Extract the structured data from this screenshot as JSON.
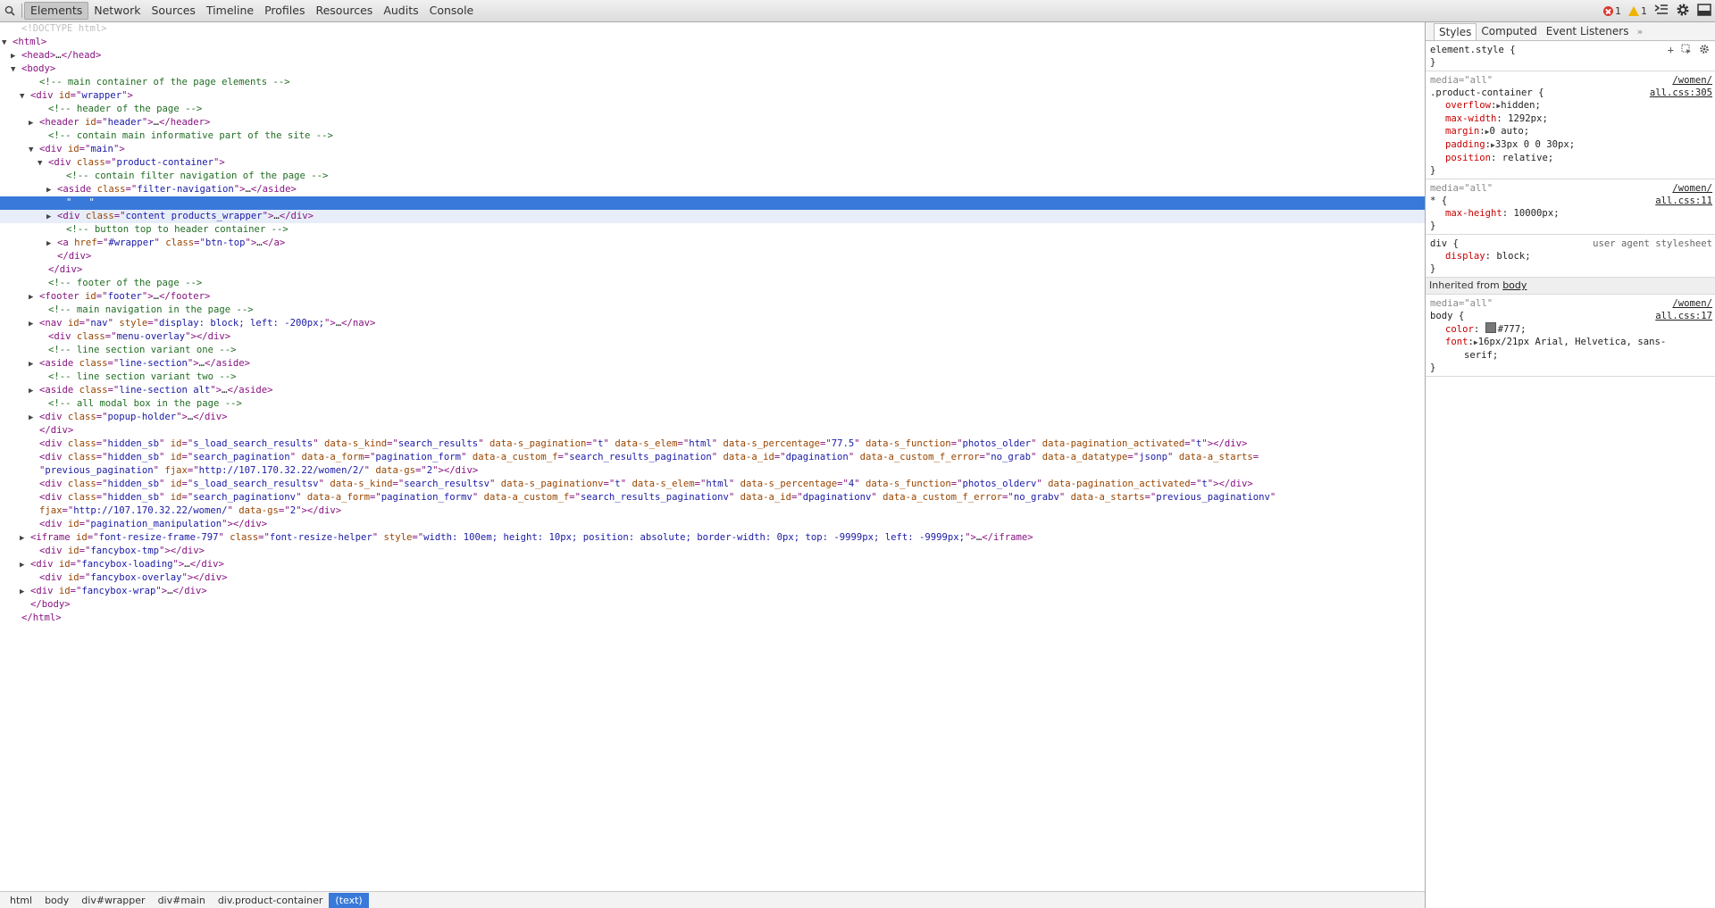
{
  "toolbar": {
    "tabs": [
      "Elements",
      "Network",
      "Sources",
      "Timeline",
      "Profiles",
      "Resources",
      "Audits",
      "Console"
    ],
    "error_count": "1",
    "warning_count": "1"
  },
  "dom_lines": [
    {
      "ind": 1,
      "tri": "",
      "html": "<span class='doctype'>&lt;!DOCTYPE html&gt;</span>"
    },
    {
      "ind": 0,
      "tri": "▼",
      "html": "<span class='tag'>&lt;html&gt;</span>"
    },
    {
      "ind": 1,
      "tri": "▶",
      "html": "<span class='tag'>&lt;head&gt;</span>…<span class='tag'>&lt;/head&gt;</span>"
    },
    {
      "ind": 1,
      "tri": "▼",
      "html": "<span class='tag'>&lt;body&gt;</span>"
    },
    {
      "ind": 3,
      "tri": "",
      "html": "<span class='cmt'>&lt;!-- main container of the page elements --&gt;</span>"
    },
    {
      "ind": 2,
      "tri": "▼",
      "html": "<span class='tag'>&lt;div </span><span class='attr'>id</span><span class='tag'>=\"</span><span class='val'>wrapper</span><span class='tag'>\"&gt;</span>"
    },
    {
      "ind": 4,
      "tri": "",
      "html": "<span class='cmt'>&lt;!-- header of the page --&gt;</span>"
    },
    {
      "ind": 3,
      "tri": "▶",
      "html": "<span class='tag'>&lt;header </span><span class='attr'>id</span><span class='tag'>=\"</span><span class='val'>header</span><span class='tag'>\"&gt;</span>…<span class='tag'>&lt;/header&gt;</span>"
    },
    {
      "ind": 4,
      "tri": "",
      "html": "<span class='cmt'>&lt;!-- contain main informative part of the site --&gt;</span>"
    },
    {
      "ind": 3,
      "tri": "▼",
      "html": "<span class='tag'>&lt;div </span><span class='attr'>id</span><span class='tag'>=\"</span><span class='val'>main</span><span class='tag'>\"&gt;</span>"
    },
    {
      "ind": 4,
      "tri": "▼",
      "html": "<span class='tag'>&lt;div </span><span class='attr'>class</span><span class='tag'>=\"</span><span class='val'>product-container</span><span class='tag'>\"&gt;</span>"
    },
    {
      "ind": 6,
      "tri": "",
      "html": "<span class='cmt'>&lt;!-- contain filter navigation of the page --&gt;</span>"
    },
    {
      "ind": 5,
      "tri": "▶",
      "html": "<span class='tag'>&lt;aside </span><span class='attr'>class</span><span class='tag'>=\"</span><span class='val'>filter-navigation</span><span class='tag'>\"&gt;</span>…<span class='tag'>&lt;/aside&gt;</span>"
    },
    {
      "ind": 6,
      "tri": "",
      "html": "\"   \"",
      "sel": true
    },
    {
      "ind": 5,
      "tri": "▶",
      "html": "<span class='tag'>&lt;div </span><span class='attr'>class</span><span class='tag'>=\"</span><span class='val'>content products_wrapper</span><span class='tag'>\"&gt;</span>…<span class='tag'>&lt;/div&gt;</span>",
      "hover": true
    },
    {
      "ind": 6,
      "tri": "",
      "html": "<span class='cmt'>&lt;!-- button top to header container --&gt;</span>"
    },
    {
      "ind": 5,
      "tri": "▶",
      "html": "<span class='tag'>&lt;a </span><span class='attr'>href</span><span class='tag'>=\"</span><span class='val'>#wrapper</span><span class='tag'>\" </span><span class='attr'>class</span><span class='tag'>=\"</span><span class='val'>btn-top</span><span class='tag'>\"&gt;</span>…<span class='tag'>&lt;/a&gt;</span>"
    },
    {
      "ind": 5,
      "tri": "",
      "html": "<span class='tag'>&lt;/div&gt;</span>"
    },
    {
      "ind": 4,
      "tri": "",
      "html": "<span class='tag'>&lt;/div&gt;</span>"
    },
    {
      "ind": 4,
      "tri": "",
      "html": "<span class='cmt'>&lt;!-- footer of the page --&gt;</span>"
    },
    {
      "ind": 3,
      "tri": "▶",
      "html": "<span class='tag'>&lt;footer </span><span class='attr'>id</span><span class='tag'>=\"</span><span class='val'>footer</span><span class='tag'>\"&gt;</span>…<span class='tag'>&lt;/footer&gt;</span>"
    },
    {
      "ind": 4,
      "tri": "",
      "html": "<span class='cmt'>&lt;!-- main navigation in the page --&gt;</span>"
    },
    {
      "ind": 3,
      "tri": "▶",
      "html": "<span class='tag'>&lt;nav </span><span class='attr'>id</span><span class='tag'>=\"</span><span class='val'>nav</span><span class='tag'>\" </span><span class='attr'>style</span><span class='tag'>=\"</span><span class='val'>display: block; left: -200px;</span><span class='tag'>\"&gt;</span>…<span class='tag'>&lt;/nav&gt;</span>"
    },
    {
      "ind": 4,
      "tri": "",
      "html": "<span class='tag'>&lt;div </span><span class='attr'>class</span><span class='tag'>=\"</span><span class='val'>menu-overlay</span><span class='tag'>\"&gt;&lt;/div&gt;</span>"
    },
    {
      "ind": 4,
      "tri": "",
      "html": "<span class='cmt'>&lt;!-- line section variant one --&gt;</span>"
    },
    {
      "ind": 3,
      "tri": "▶",
      "html": "<span class='tag'>&lt;aside </span><span class='attr'>class</span><span class='tag'>=\"</span><span class='val'>line-section</span><span class='tag'>\"&gt;</span>…<span class='tag'>&lt;/aside&gt;</span>"
    },
    {
      "ind": 4,
      "tri": "",
      "html": "<span class='cmt'>&lt;!-- line section variant two --&gt;</span>"
    },
    {
      "ind": 3,
      "tri": "▶",
      "html": "<span class='tag'>&lt;aside </span><span class='attr'>class</span><span class='tag'>=\"</span><span class='val'>line-section alt</span><span class='tag'>\"&gt;</span>…<span class='tag'>&lt;/aside&gt;</span>"
    },
    {
      "ind": 4,
      "tri": "",
      "html": "<span class='cmt'>&lt;!-- all modal box in the page --&gt;</span>"
    },
    {
      "ind": 3,
      "tri": "▶",
      "html": "<span class='tag'>&lt;div </span><span class='attr'>class</span><span class='tag'>=\"</span><span class='val'>popup-holder</span><span class='tag'>\"&gt;</span>…<span class='tag'>&lt;/div&gt;</span>"
    },
    {
      "ind": 3,
      "tri": "",
      "html": "<span class='tag'>&lt;/div&gt;</span>"
    },
    {
      "ind": 3,
      "tri": "",
      "html": "<span class='tag'>&lt;div </span><span class='attr'>class</span><span class='tag'>=\"</span><span class='val'>hidden_sb</span><span class='tag'>\" </span><span class='attr'>id</span><span class='tag'>=\"</span><span class='val'>s_load_search_results</span><span class='tag'>\" </span><span class='attr'>data-s_kind</span><span class='tag'>=\"</span><span class='val'>search_results</span><span class='tag'>\" </span><span class='attr'>data-s_pagination</span><span class='tag'>=\"</span><span class='val'>t</span><span class='tag'>\" </span><span class='attr'>data-s_elem</span><span class='tag'>=\"</span><span class='val'>html</span><span class='tag'>\" </span><span class='attr'>data-s_percentage</span><span class='tag'>=\"</span><span class='val'>77.5</span><span class='tag'>\" </span><span class='attr'>data-s_function</span><span class='tag'>=\"</span><span class='val'>photos_older</span><span class='tag'>\" </span><span class='attr'>data-pagination_activated</span><span class='tag'>=\"</span><span class='val'>t</span><span class='tag'>\"&gt;&lt;/div&gt;</span>"
    },
    {
      "ind": 3,
      "tri": "",
      "html": "<span class='tag'>&lt;div </span><span class='attr'>class</span><span class='tag'>=\"</span><span class='val'>hidden_sb</span><span class='tag'>\" </span><span class='attr'>id</span><span class='tag'>=\"</span><span class='val'>search_pagination</span><span class='tag'>\" </span><span class='attr'>data-a_form</span><span class='tag'>=\"</span><span class='val'>pagination_form</span><span class='tag'>\" </span><span class='attr'>data-a_custom_f</span><span class='tag'>=\"</span><span class='val'>search_results_pagination</span><span class='tag'>\" </span><span class='attr'>data-a_id</span><span class='tag'>=\"</span><span class='val'>dpagination</span><span class='tag'>\" </span><span class='attr'>data-a_custom_f_error</span><span class='tag'>=\"</span><span class='val'>no_grab</span><span class='tag'>\" </span><span class='attr'>data-a_datatype</span><span class='tag'>=\"</span><span class='val'>jsonp</span><span class='tag'>\" </span><span class='attr'>data-a_starts</span><span class='tag'>=</span>"
    },
    {
      "ind": 3,
      "tri": "",
      "html": "<span class='tag'>\"</span><span class='val'>previous_pagination</span><span class='tag'>\" </span><span class='attr'>fjax</span><span class='tag'>=\"</span><span class='val'>http://107.170.32.22/women/2/</span><span class='tag'>\" </span><span class='attr'>data-gs</span><span class='tag'>=\"</span><span class='val'>2</span><span class='tag'>\"&gt;&lt;/div&gt;</span>"
    },
    {
      "ind": 3,
      "tri": "",
      "html": "<span class='tag'>&lt;div </span><span class='attr'>class</span><span class='tag'>=\"</span><span class='val'>hidden_sb</span><span class='tag'>\" </span><span class='attr'>id</span><span class='tag'>=\"</span><span class='val'>s_load_search_resultsv</span><span class='tag'>\" </span><span class='attr'>data-s_kind</span><span class='tag'>=\"</span><span class='val'>search_resultsv</span><span class='tag'>\" </span><span class='attr'>data-s_paginationv</span><span class='tag'>=\"</span><span class='val'>t</span><span class='tag'>\" </span><span class='attr'>data-s_elem</span><span class='tag'>=\"</span><span class='val'>html</span><span class='tag'>\" </span><span class='attr'>data-s_percentage</span><span class='tag'>=\"</span><span class='val'>4</span><span class='tag'>\" </span><span class='attr'>data-s_function</span><span class='tag'>=\"</span><span class='val'>photos_olderv</span><span class='tag'>\" </span><span class='attr'>data-pagination_activated</span><span class='tag'>=\"</span><span class='val'>t</span><span class='tag'>\"&gt;&lt;/div&gt;</span>"
    },
    {
      "ind": 3,
      "tri": "",
      "html": "<span class='tag'>&lt;div </span><span class='attr'>class</span><span class='tag'>=\"</span><span class='val'>hidden_sb</span><span class='tag'>\" </span><span class='attr'>id</span><span class='tag'>=\"</span><span class='val'>search_paginationv</span><span class='tag'>\" </span><span class='attr'>data-a_form</span><span class='tag'>=\"</span><span class='val'>pagination_formv</span><span class='tag'>\" </span><span class='attr'>data-a_custom_f</span><span class='tag'>=\"</span><span class='val'>search_results_paginationv</span><span class='tag'>\" </span><span class='attr'>data-a_id</span><span class='tag'>=\"</span><span class='val'>dpaginationv</span><span class='tag'>\" </span><span class='attr'>data-a_custom_f_error</span><span class='tag'>=\"</span><span class='val'>no_grabv</span><span class='tag'>\" </span><span class='attr'>data-a_starts</span><span class='tag'>=\"</span><span class='val'>previous_paginationv</span><span class='tag'>\"</span>"
    },
    {
      "ind": 3,
      "tri": "",
      "html": "<span class='attr'>fjax</span><span class='tag'>=\"</span><span class='val'>http://107.170.32.22/women/</span><span class='tag'>\" </span><span class='attr'>data-gs</span><span class='tag'>=\"</span><span class='val'>2</span><span class='tag'>\"&gt;&lt;/div&gt;</span>"
    },
    {
      "ind": 3,
      "tri": "",
      "html": "<span class='tag'>&lt;div </span><span class='attr'>id</span><span class='tag'>=\"</span><span class='val'>pagination_manipulation</span><span class='tag'>\"&gt;&lt;/div&gt;</span>"
    },
    {
      "ind": 2,
      "tri": "▶",
      "html": "<span class='tag'>&lt;iframe </span><span class='attr'>id</span><span class='tag'>=\"</span><span class='val'>font-resize-frame-797</span><span class='tag'>\" </span><span class='attr'>class</span><span class='tag'>=\"</span><span class='val'>font-resize-helper</span><span class='tag'>\" </span><span class='attr'>style</span><span class='tag'>=\"</span><span class='val'>width: 100em; height: 10px; position: absolute; border-width: 0px; top: -9999px; left: -9999px;</span><span class='tag'>\"&gt;</span>…<span class='tag'>&lt;/iframe&gt;</span>"
    },
    {
      "ind": 3,
      "tri": "",
      "html": "<span class='tag'>&lt;div </span><span class='attr'>id</span><span class='tag'>=\"</span><span class='val'>fancybox-tmp</span><span class='tag'>\"&gt;&lt;/div&gt;</span>"
    },
    {
      "ind": 2,
      "tri": "▶",
      "html": "<span class='tag'>&lt;div </span><span class='attr'>id</span><span class='tag'>=\"</span><span class='val'>fancybox-loading</span><span class='tag'>\"&gt;</span>…<span class='tag'>&lt;/div&gt;</span>"
    },
    {
      "ind": 3,
      "tri": "",
      "html": "<span class='tag'>&lt;div </span><span class='attr'>id</span><span class='tag'>=\"</span><span class='val'>fancybox-overlay</span><span class='tag'>\"&gt;&lt;/div&gt;</span>"
    },
    {
      "ind": 2,
      "tri": "▶",
      "html": "<span class='tag'>&lt;div </span><span class='attr'>id</span><span class='tag'>=\"</span><span class='val'>fancybox-wrap</span><span class='tag'>\"&gt;</span>…<span class='tag'>&lt;/div&gt;</span>"
    },
    {
      "ind": 2,
      "tri": "",
      "html": "<span class='tag'>&lt;/body&gt;</span>"
    },
    {
      "ind": 1,
      "tri": "",
      "html": "<span class='tag'>&lt;/html&gt;</span>"
    }
  ],
  "breadcrumbs": [
    "html",
    "body",
    "div#wrapper",
    "div#main",
    "div.product-container",
    "(text)"
  ],
  "sidebar": {
    "tabs": [
      "Styles",
      "Computed",
      "Event Listeners"
    ],
    "more": "»",
    "element_style": {
      "selector": "element.style {",
      "close": "}"
    },
    "rules": [
      {
        "media": "media=\"all\"",
        "src1": "/women/",
        "src2": "all.css:305",
        "selector": ".product-container {",
        "props": [
          {
            "name": "overflow",
            "tri": true,
            "value": "hidden;"
          },
          {
            "name": "max-width",
            "tri": false,
            "value": "1292px;"
          },
          {
            "name": "margin",
            "tri": true,
            "value": "0 auto;"
          },
          {
            "name": "padding",
            "tri": true,
            "value": "33px 0 0 30px;"
          },
          {
            "name": "position",
            "tri": false,
            "value": "relative;"
          }
        ]
      },
      {
        "media": "media=\"all\"",
        "src1": "/women/",
        "src2": "all.css:11",
        "selector": "* {",
        "props": [
          {
            "name": "max-height",
            "tri": false,
            "value": "10000px;"
          }
        ]
      },
      {
        "media": "",
        "src1": "user agent stylesheet",
        "src2": "",
        "ua": true,
        "selector": "div {",
        "props": [
          {
            "name": "display",
            "tri": false,
            "value": "block;"
          }
        ]
      }
    ],
    "inherited_label": "Inherited from",
    "inherited_link": "body",
    "body_rule": {
      "media": "media=\"all\"",
      "src1": "/women/",
      "src2": "all.css:17",
      "selector": "body {",
      "color_name": "color",
      "color_value": "#777;",
      "font_name": "font",
      "font_value": "16px/21px Arial, Helvetica, sans-",
      "font_value2": "serif;"
    }
  },
  "colors": {
    "selection": "#3879d9",
    "tag": "#881280",
    "attr": "#994500",
    "value": "#1a1aa6",
    "comment": "#236e25"
  }
}
